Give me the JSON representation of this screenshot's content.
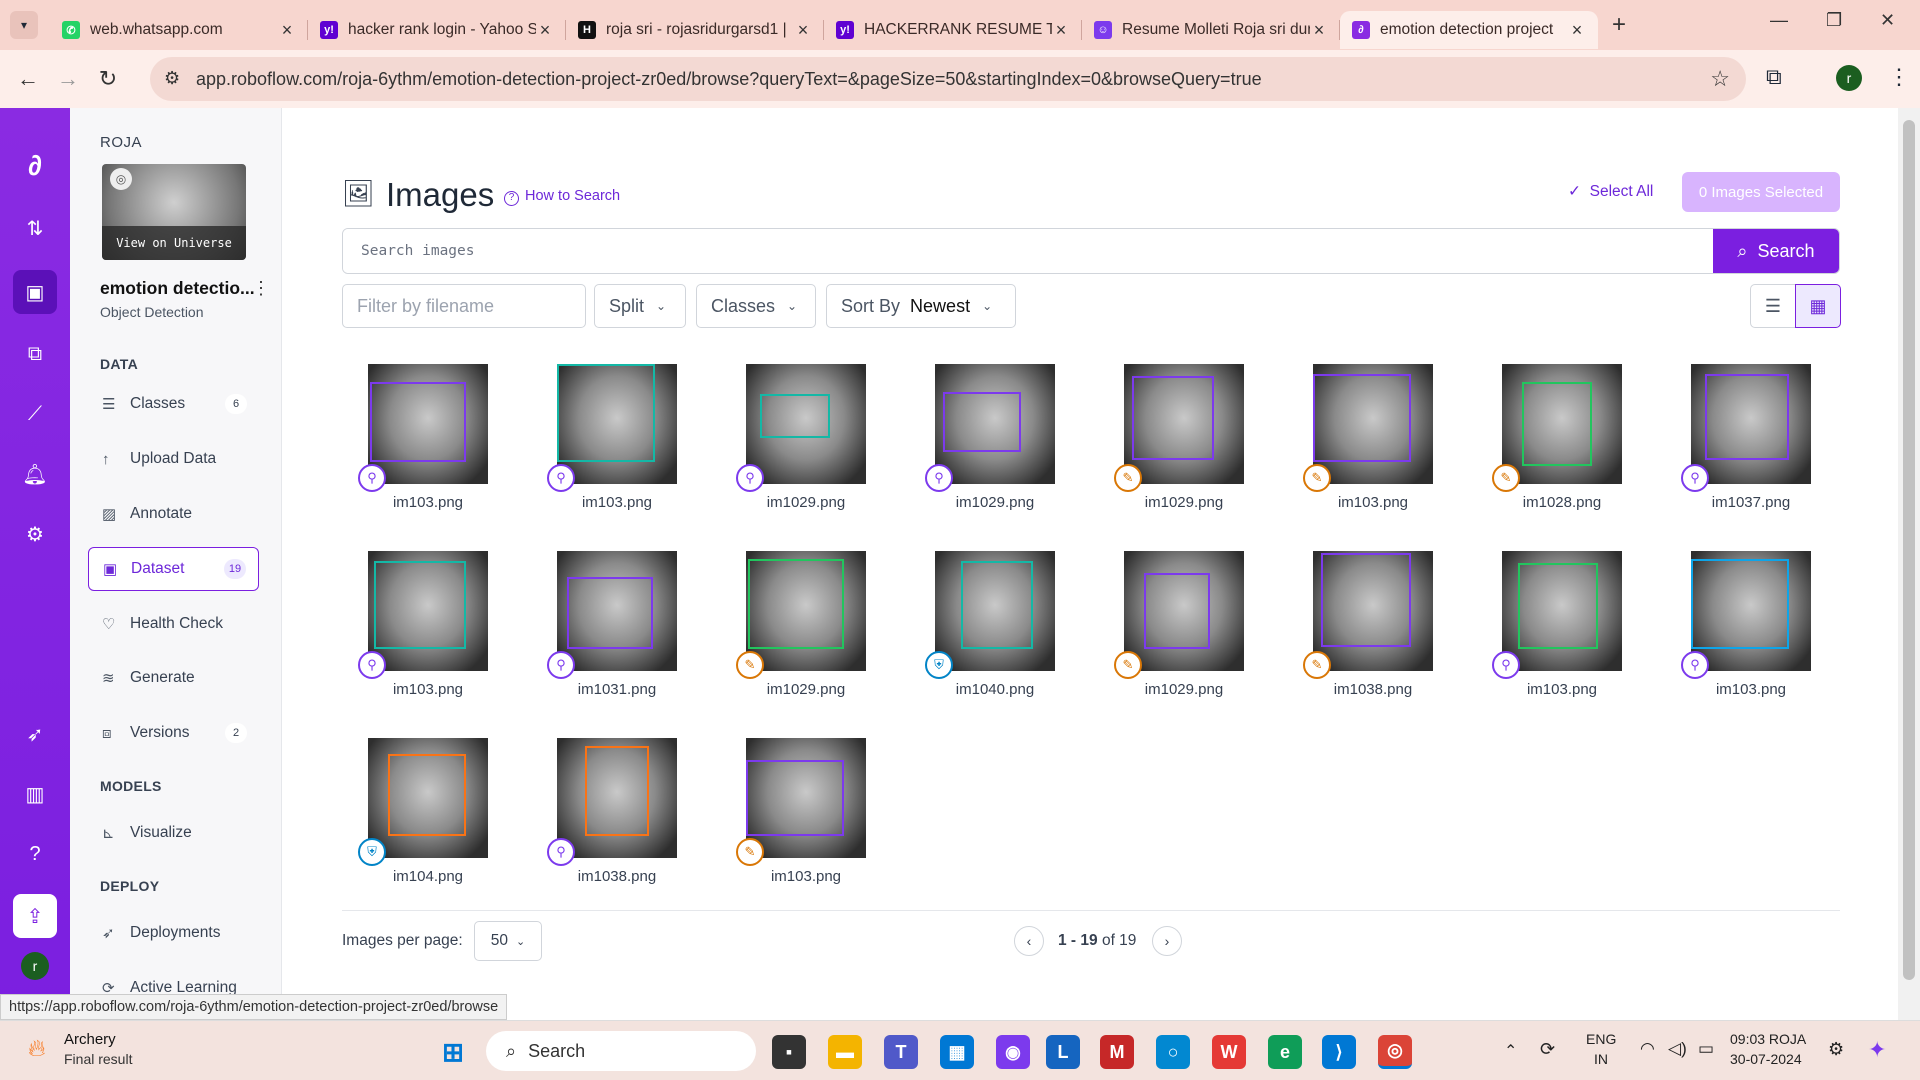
{
  "browser": {
    "tabs": [
      {
        "title": "web.whatsapp.com",
        "favicon": "whatsapp-icon",
        "color": "#25d366",
        "glyph": "✆"
      },
      {
        "title": "hacker rank login - Yahoo S",
        "favicon": "yahoo-icon",
        "color": "#6001d2",
        "glyph": "y!"
      },
      {
        "title": "roja sri - rojasridurgarsd1 |",
        "favicon": "hackerrank-icon",
        "color": "#111111",
        "glyph": "H"
      },
      {
        "title": "HACKERRANK RESUME TEMP",
        "favicon": "yahoo-icon",
        "color": "#6001d2",
        "glyph": "y!"
      },
      {
        "title": "Resume Molleti Roja sri dur",
        "favicon": "ai-icon",
        "color": "#7c3aed",
        "glyph": "☺"
      },
      {
        "title": "emotion detection project",
        "favicon": "roboflow-icon",
        "color": "#8a2be2",
        "glyph": "∂"
      }
    ],
    "url": "app.roboflow.com/roja-6ythm/emotion-detection-project-zr0ed/browse?queryText=&pageSize=50&startingIndex=0&browseQuery=true",
    "status_url": "https://app.roboflow.com/roja-6ythm/emotion-detection-project-zr0ed/browse",
    "profile_initial": "r"
  },
  "sidebar": {
    "workspace": "ROJA",
    "view_universe": "View on Universe",
    "project_name": "emotion detectio...",
    "project_type": "Object Detection",
    "sections": {
      "data": "DATA",
      "models": "MODELS",
      "deploy": "DEPLOY"
    },
    "items": {
      "classes": {
        "label": "Classes",
        "count": "6"
      },
      "upload": {
        "label": "Upload Data"
      },
      "annotate": {
        "label": "Annotate"
      },
      "dataset": {
        "label": "Dataset",
        "count": "19"
      },
      "health": {
        "label": "Health Check"
      },
      "generate": {
        "label": "Generate"
      },
      "versions": {
        "label": "Versions",
        "count": "2"
      },
      "visualize": {
        "label": "Visualize"
      },
      "deployments": {
        "label": "Deployments"
      },
      "active_learning": {
        "label": "Active Learning"
      }
    },
    "user_initial": "r"
  },
  "main": {
    "title": "Images",
    "how_to": "How to Search",
    "select_all": "Select All",
    "selected": "0 Images Selected",
    "search_placeholder": "Search images",
    "search_button": "Search",
    "filter_placeholder": "Filter by filename",
    "split": "Split",
    "classes": "Classes",
    "sort_label": "Sort By",
    "sort_value": "Newest",
    "per_page_label": "Images per page:",
    "per_page_value": "50",
    "pagination": {
      "range": "1 - 19",
      "of": "of 19"
    }
  },
  "images": [
    {
      "file": "im103.png",
      "box": "#7c3aed",
      "status": "unassigned"
    },
    {
      "file": "im103.png",
      "box": "#14b8a6",
      "status": "unassigned"
    },
    {
      "file": "im1029.png",
      "box": "#14b8a6",
      "status": "unassigned"
    },
    {
      "file": "im1029.png",
      "box": "#7c3aed",
      "status": "unassigned"
    },
    {
      "file": "im1029.png",
      "box": "#7c3aed",
      "status": "annotated"
    },
    {
      "file": "im103.png",
      "box": "#7c3aed",
      "status": "annotated"
    },
    {
      "file": "im1028.png",
      "box": "#22c55e",
      "status": "annotated"
    },
    {
      "file": "im1037.png",
      "box": "#7c3aed",
      "status": "unassigned"
    },
    {
      "file": "im103.png",
      "box": "#14b8a6",
      "status": "unassigned"
    },
    {
      "file": "im1031.png",
      "box": "#7c3aed",
      "status": "unassigned"
    },
    {
      "file": "im1029.png",
      "box": "#22c55e",
      "status": "annotated"
    },
    {
      "file": "im1040.png",
      "box": "#14b8a6",
      "status": "approved"
    },
    {
      "file": "im1029.png",
      "box": "#7c3aed",
      "status": "annotated"
    },
    {
      "file": "im1038.png",
      "box": "#7c3aed",
      "status": "annotated"
    },
    {
      "file": "im103.png",
      "box": "#22c55e",
      "status": "unassigned"
    },
    {
      "file": "im103.png",
      "box": "#0ea5e9",
      "status": "unassigned"
    },
    {
      "file": "im104.png",
      "box": "#f97316",
      "status": "approved"
    },
    {
      "file": "im1038.png",
      "box": "#f97316",
      "status": "unassigned"
    },
    {
      "file": "im103.png",
      "box": "#7c3aed",
      "status": "annotated"
    }
  ],
  "taskbar": {
    "weather_title": "Archery",
    "weather_sub": "Final result",
    "search": "Search",
    "lang": "ENG",
    "region": "IN",
    "time": "09:03 ROJA",
    "date": "30-07-2024"
  },
  "colors": {
    "brand": "#7b1fe0",
    "unassigned": "#7c3aed",
    "annotated": "#d97706",
    "approved": "#0284c7"
  }
}
